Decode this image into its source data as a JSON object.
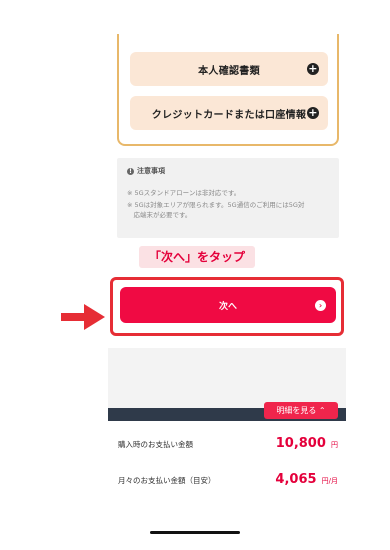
{
  "documents": {
    "button1_label": "本人確認書類",
    "button2_label": "クレジットカードまたは口座情報",
    "icon": "plus-circle-icon"
  },
  "notice": {
    "title": "注意事項",
    "items": [
      "※ 5Gスタンドアローンは非対応です。",
      "※ 5Gは対象エリアが限られます。5G通信のご利用には5G対",
      "　応端末が必要です。"
    ]
  },
  "annotation": {
    "label": "「次へ」をタップ",
    "color": "#e4003b",
    "box_color": "#e62d35"
  },
  "next_button": {
    "label": "次へ",
    "color": "#f00a43"
  },
  "details_button": {
    "label": "明細を見る ⌃"
  },
  "prices": {
    "purchase_label": "購入時のお支払い金額",
    "purchase_value": "10,800",
    "purchase_unit": "円",
    "monthly_label": "月々のお支払い金額（目安）",
    "monthly_value": "4,065",
    "monthly_unit": "円/月"
  }
}
